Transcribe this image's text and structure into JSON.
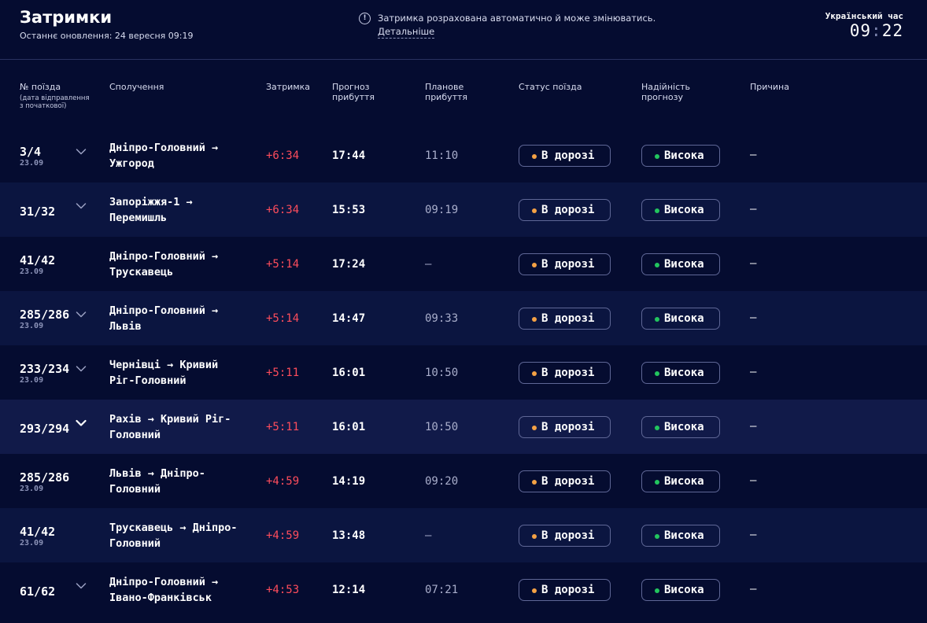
{
  "header": {
    "title": "Затримки",
    "updated": "Останнє оновлення: 24 вересня 09:19",
    "notice_text": "Затримка розрахована автоматично й може змінюватись.",
    "notice_link": "Детальніше",
    "clock_label": "Український час",
    "clock_hours": "09",
    "clock_minutes": "22"
  },
  "columns": {
    "train": "№ поїзда",
    "train_sub": "(дата відправлення з початкової)",
    "route": "Сполучення",
    "delay": "Затримка",
    "forecast": "Прогноз прибуття",
    "planned": "Планове прибуття",
    "status": "Статус поїзда",
    "reliability": "Надійність прогнозу",
    "reason": "Причина"
  },
  "rows": [
    {
      "num": "3/4",
      "date": "23.09",
      "route": "Дніпро-Головний → Ужгород",
      "delay": "+6:34",
      "forecast": "17:44",
      "planned": "11:10",
      "status": "В дорозі",
      "reliability": "Висока",
      "reason": "—",
      "expandable": true
    },
    {
      "num": "31/32",
      "date": "",
      "route": "Запоріжжя-1 → Перемишль",
      "delay": "+6:34",
      "forecast": "15:53",
      "planned": "09:19",
      "status": "В дорозі",
      "reliability": "Висока",
      "reason": "—",
      "expandable": true
    },
    {
      "num": "41/42",
      "date": "23.09",
      "route": "Дніпро-Головний → Трускавець",
      "delay": "+5:14",
      "forecast": "17:24",
      "planned": "—",
      "status": "В дорозі",
      "reliability": "Висока",
      "reason": "—",
      "expandable": false
    },
    {
      "num": "285/286",
      "date": "23.09",
      "route": "Дніпро-Головний → Львів",
      "delay": "+5:14",
      "forecast": "14:47",
      "planned": "09:33",
      "status": "В дорозі",
      "reliability": "Висока",
      "reason": "—",
      "expandable": true
    },
    {
      "num": "233/234",
      "date": "23.09",
      "route": "Чернівці → Кривий Ріг-Головний",
      "delay": "+5:11",
      "forecast": "16:01",
      "planned": "10:50",
      "status": "В дорозі",
      "reliability": "Висока",
      "reason": "—",
      "expandable": true
    },
    {
      "num": "293/294",
      "date": "",
      "route": "Рахів → Кривий Ріг-Головний",
      "delay": "+5:11",
      "forecast": "16:01",
      "planned": "10:50",
      "status": "В дорозі",
      "reliability": "Висока",
      "reason": "—",
      "expandable": true
    },
    {
      "num": "285/286",
      "date": "23.09",
      "route": "Львів → Дніпро-Головний",
      "delay": "+4:59",
      "forecast": "14:19",
      "planned": "09:20",
      "status": "В дорозі",
      "reliability": "Висока",
      "reason": "—",
      "expandable": false
    },
    {
      "num": "41/42",
      "date": "23.09",
      "route": "Трускавець → Дніпро-Головний",
      "delay": "+4:59",
      "forecast": "13:48",
      "planned": "—",
      "status": "В дорозі",
      "reliability": "Висока",
      "reason": "—",
      "expandable": false
    },
    {
      "num": "61/62",
      "date": "",
      "route": "Дніпро-Головний → Івано-Франківськ",
      "delay": "+4:53",
      "forecast": "12:14",
      "planned": "07:21",
      "status": "В дорозі",
      "reliability": "Висока",
      "reason": "—",
      "expandable": true
    }
  ],
  "colors": {
    "background": "#050c30",
    "delay": "#ff4d5c",
    "status_dot": "#f4a145",
    "reliability_dot": "#22c55e"
  }
}
